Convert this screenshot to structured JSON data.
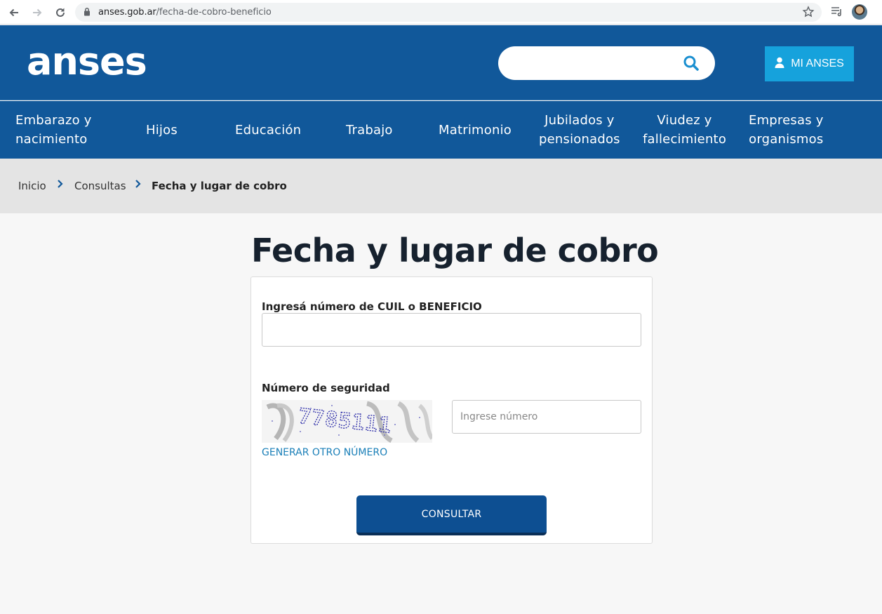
{
  "browser": {
    "url_domain": "anses.gob.ar",
    "url_path": "/fecha-de-cobro-beneficio"
  },
  "header": {
    "logo": "anses",
    "search_placeholder": "",
    "mi_anses_label": "MI ANSES"
  },
  "menu": {
    "items": [
      {
        "line1": "Embarazo y",
        "line2": "nacimiento"
      },
      {
        "line1": "Hijos",
        "line2": ""
      },
      {
        "line1": "Educación",
        "line2": ""
      },
      {
        "line1": "Trabajo",
        "line2": ""
      },
      {
        "line1": "Matrimonio",
        "line2": ""
      },
      {
        "line1": "Jubilados y",
        "line2": "pensionados"
      },
      {
        "line1": "Viudez y",
        "line2": "fallecimiento"
      },
      {
        "line1": "Empresas y",
        "line2": "organismos"
      }
    ]
  },
  "breadcrumb": {
    "items": [
      "Inicio",
      "Consultas",
      "Fecha y lugar de cobro"
    ]
  },
  "page": {
    "title": "Fecha y lugar de cobro"
  },
  "form": {
    "cuil_label": "Ingresá número de CUIL o BENEFICIO",
    "cuil_value": "",
    "security_label": "Número de seguridad",
    "captcha_text": "7785111",
    "captcha_input_placeholder": "Ingrese número",
    "regenerate_label": "GENERAR OTRO NÚMERO",
    "submit_label": "CONSULTAR"
  },
  "colors": {
    "brand_blue": "#11589a",
    "accent_cyan": "#16a2dc",
    "button_blue": "#0d4f92"
  }
}
